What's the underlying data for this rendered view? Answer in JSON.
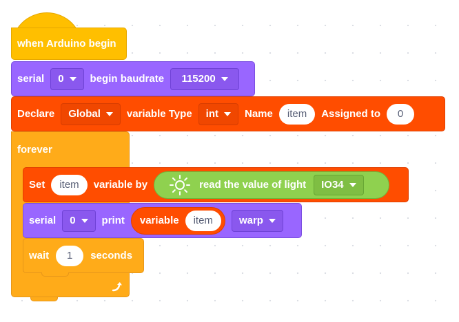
{
  "hat": {
    "label": "when Arduino begin"
  },
  "serial_begin": {
    "label": "serial",
    "port": "0",
    "middle": "begin baudrate",
    "baud": "115200"
  },
  "declare": {
    "label": "Declare",
    "scope": "Global",
    "type_label": "variable Type",
    "type": "int",
    "name_label": "Name",
    "name": "item",
    "assign_label": "Assigned to",
    "value": "0"
  },
  "forever": {
    "label": "forever"
  },
  "set": {
    "label": "Set",
    "var": "item",
    "by_label": "variable by",
    "sensor_label": "read the value of light",
    "pin": "IO34"
  },
  "serial_print": {
    "label": "serial",
    "port": "0",
    "print_label": "print",
    "variable_label": "variable",
    "var": "item",
    "mode": "warp"
  },
  "wait": {
    "label": "wait",
    "value": "1",
    "unit": "seconds"
  },
  "colors": {
    "events": "#ffbf00",
    "control": "#ffab19",
    "serial": "#9966ff",
    "variables": "#ff4d00",
    "sensor": "#8fd14f",
    "canvas": "#ffffff"
  },
  "icons": {
    "sensor": "light-sensor-icon",
    "loop": "loop-arrow-icon"
  }
}
